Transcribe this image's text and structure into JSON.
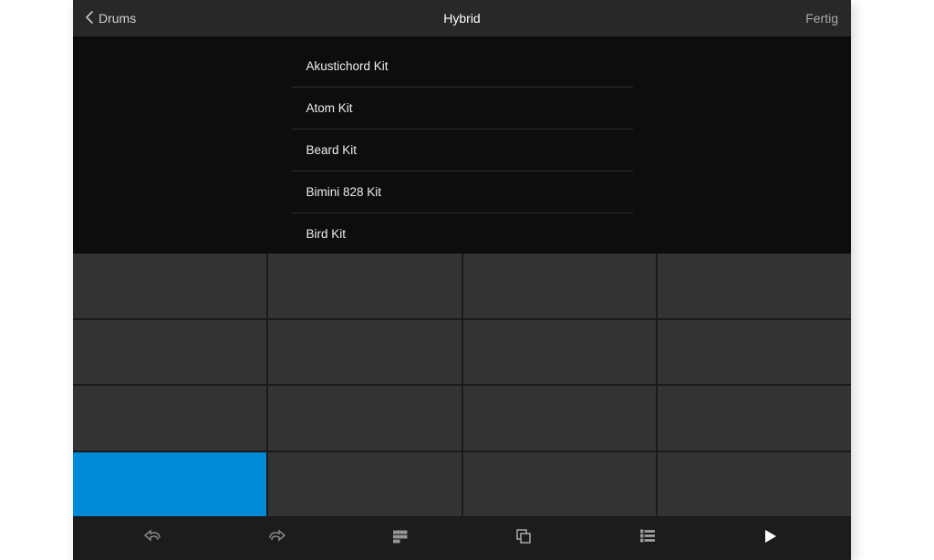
{
  "header": {
    "back_label": "Drums",
    "title": "Hybrid",
    "done_label": "Fertig"
  },
  "kits": [
    "Akustichord Kit",
    "Atom Kit",
    "Beard Kit",
    "Bimini 828 Kit",
    "Bird Kit"
  ],
  "pads": {
    "rows": 4,
    "cols": 4,
    "active_index": 12
  },
  "colors": {
    "accent": "#0089d6"
  },
  "toolbar": {
    "undo": "undo-icon",
    "redo": "redo-icon",
    "grid": "grid-icon",
    "copy": "copy-icon",
    "list": "list-icon",
    "play": "play-icon"
  }
}
